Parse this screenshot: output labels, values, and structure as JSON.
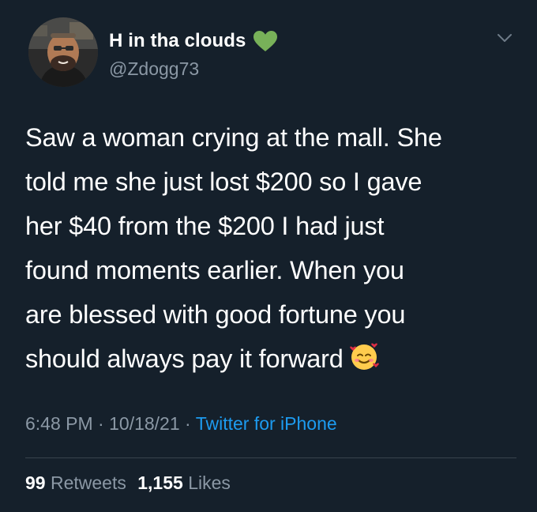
{
  "user": {
    "display_name": "H in tha clouds",
    "handle": "@Zdogg73",
    "badge_icon": "green-heart-icon"
  },
  "tweet": {
    "lines": [
      "Saw a woman crying at the mall. She",
      "told me she just lost $200 so I gave",
      "her $40 from the $200 I had just",
      "found moments earlier. When you",
      "are blessed with good fortune you",
      "should always pay it forward"
    ],
    "trailing_emoji": "smiling-face-with-hearts-icon"
  },
  "meta": {
    "time": "6:48 PM",
    "sep1": "·",
    "date": "10/18/21",
    "sep2": "·",
    "source": "Twitter for iPhone"
  },
  "stats": {
    "retweets_count": "99",
    "retweets_label": "Retweets",
    "likes_count": "1,155",
    "likes_label": "Likes"
  },
  "colors": {
    "background": "#15202b",
    "text_primary": "#ffffff",
    "text_secondary": "#8b98a5",
    "link": "#1d9bf0",
    "divider": "#38444d",
    "heart": "#78b159"
  }
}
